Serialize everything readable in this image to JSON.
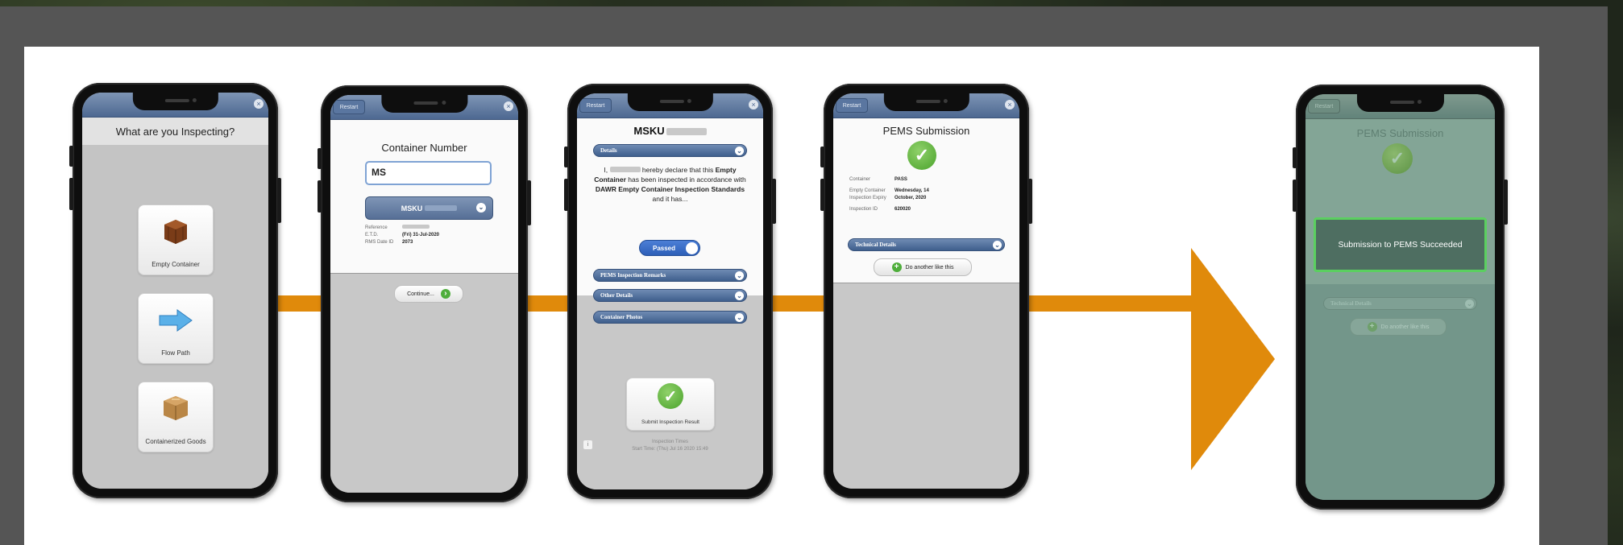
{
  "screen1": {
    "title": "What are you Inspecting?",
    "tiles": [
      "Empty Container",
      "Flow Path",
      "Containerized Goods"
    ]
  },
  "screen2": {
    "topbar_button": "Restart",
    "close": "×",
    "title": "Container Number",
    "input_value": "MS",
    "select_value": "MSKU",
    "fields": [
      {
        "label": "Reference",
        "value": ""
      },
      {
        "label": "E.T.D.",
        "value": "(Fri) 31-Jul-2020"
      },
      {
        "label": "RMS Date ID",
        "value": "2073"
      }
    ],
    "continue_label": "Continue..."
  },
  "screen3": {
    "topbar_button": "Restart",
    "close": "×",
    "title": "MSKU",
    "details_bar": "Details",
    "declaration_1": "I,",
    "declaration_2": "hereby declare that this",
    "declaration_bold_1": "Empty Container",
    "declaration_3": "has been inspected in accordance with",
    "declaration_bold_2": "DAWR Empty Container Inspection Standards",
    "declaration_4": "and it has...",
    "toggle_label": "Passed",
    "bars": [
      "PEMS Inspection Remarks",
      "Other Details",
      "Container Photos"
    ],
    "submit_label": "Submit Inspection Result",
    "footer_label": "Inspection Times",
    "footer_value": "Start Time: (Thu) Jul 16 2020 15:49"
  },
  "screen4": {
    "topbar_button": "Restart",
    "close": "×",
    "title": "PEMS Submission",
    "rows": [
      {
        "label": "Container",
        "value": "PASS"
      },
      {
        "label": "Empty Container Inspection Expiry",
        "value": "Wednesday, 14 October, 2020"
      },
      {
        "label": "Inspection ID",
        "value": "620020"
      }
    ],
    "technical_bar": "Technical Details",
    "again_label": "Do another like this"
  },
  "screen5": {
    "topbar_button": "Restart",
    "title": "PEMS Submission",
    "toast": "Submission to PEMS Succeeded",
    "technical_bar": "Technical Details",
    "again_label": "Do another like this"
  },
  "colors": {
    "arrow": "#e08a0b",
    "accent_blue": "#4d6891",
    "success_green": "#4fae3c"
  }
}
